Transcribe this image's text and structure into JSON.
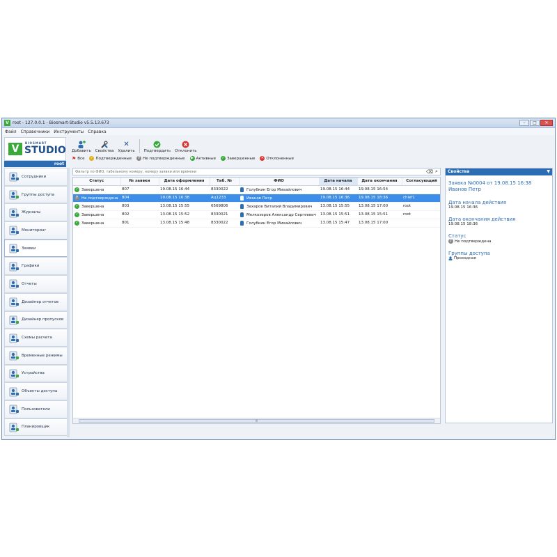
{
  "window": {
    "title": "root - 127.0.0.1 - Biosmart-Studio v5.5.13.673"
  },
  "menu": [
    "Файл",
    "Справочники",
    "Инструменты",
    "Справка"
  ],
  "logo": {
    "small": "BIOSMART",
    "big": "STUDIO",
    "user": "root"
  },
  "sidebar": {
    "items": [
      {
        "label": "Сотрудники",
        "icon": "employees-icon"
      },
      {
        "label": "Группы доступа",
        "icon": "access-groups-icon"
      },
      {
        "label": "Журналы",
        "icon": "journals-icon"
      },
      {
        "label": "Мониторинг",
        "icon": "monitoring-icon"
      },
      {
        "label": "Заявки",
        "icon": "requests-icon"
      },
      {
        "label": "Графики",
        "icon": "schedules-icon"
      },
      {
        "label": "Отчеты",
        "icon": "reports-icon"
      },
      {
        "label": "Дизайнер отчетов",
        "icon": "report-designer-icon"
      },
      {
        "label": "Дизайнер пропусков",
        "icon": "pass-designer-icon"
      },
      {
        "label": "Схемы расчета",
        "icon": "calc-schemes-icon"
      },
      {
        "label": "Временные режимы",
        "icon": "time-modes-icon"
      },
      {
        "label": "Устройства",
        "icon": "devices-icon"
      },
      {
        "label": "Объекты доступа",
        "icon": "access-objects-icon"
      },
      {
        "label": "Пользователи",
        "icon": "users-icon"
      },
      {
        "label": "Планировщик",
        "icon": "scheduler-icon"
      }
    ],
    "active_index": 4
  },
  "toolbar": {
    "add": "Добавить",
    "properties": "Свойства",
    "delete": "Удалить",
    "approve": "Подтвердить",
    "reject": "Отклонить"
  },
  "filters": {
    "all": "Все",
    "approved": "Подтвержденные",
    "not_approved": "Не подтвержденные",
    "active": "Активные",
    "completed": "Завершенные",
    "rejected": "Отклоненные"
  },
  "search": {
    "placeholder": "Фильтр по ФИО, табельному номеру, номеру заявки или времени"
  },
  "table": {
    "columns": [
      "Статус",
      "№ заявки",
      "Дата оформления",
      "Таб. №",
      "ФИО",
      "Дата начала",
      "Дата окончания",
      "Согласующий"
    ],
    "rows": [
      {
        "status": "Завершена",
        "num": "807",
        "created": "19.08.15 16:44",
        "tab": "8330022",
        "fio": "Голубкин Егор Михайлович",
        "start": "19.08.15 16:44",
        "end": "19.08.15 16:54",
        "approver": "",
        "kind": "done"
      },
      {
        "status": "Не подтверждена",
        "num": "804",
        "created": "19.08.15 16:38",
        "tab": "Ац1233",
        "fio": "Иванов Петр",
        "start": "19.08.15 16:36",
        "end": "19.08.15 18:36",
        "approver": "chief1",
        "kind": "pending"
      },
      {
        "status": "Завершена",
        "num": "803",
        "created": "13.08.15 15:55",
        "tab": "6569806",
        "fio": "Захаров Виталий Владимирович",
        "start": "13.08.15 15:55",
        "end": "13.08.15 17:00",
        "approver": "root",
        "kind": "done"
      },
      {
        "status": "Завершена",
        "num": "802",
        "created": "13.08.15 15:52",
        "tab": "8330021",
        "fio": "Мелкозеров Александр Сергеевич",
        "start": "13.08.15 15:51",
        "end": "13.08.15 15:51",
        "approver": "root",
        "kind": "done"
      },
      {
        "status": "Завершена",
        "num": "801",
        "created": "13.08.15 15:48",
        "tab": "8330022",
        "fio": "Голубкин Егор Михайлович",
        "start": "13.08.15 15:47",
        "end": "13.08.15 17:00",
        "approver": "",
        "kind": "done"
      }
    ],
    "selected_index": 1,
    "sorted_column": 5
  },
  "properties": {
    "header": "Свойства",
    "title": "Заявка №0004 от 19.08.15 16:38 Иванов Петр",
    "start_label": "Дата начала действия",
    "start_value": "19.08.15 16:36",
    "end_label": "Дата окончания действия",
    "end_value": "19.08.15 18:36",
    "status_label": "Статус",
    "status_value": "Не подтверждена",
    "groups_label": "Группы доступа",
    "groups_value": "Проходная"
  },
  "colors": {
    "accent": "#2b6cb3",
    "selected_row": "#3c8ee8",
    "done": "#3aa83a",
    "pending": "#8a8a8a",
    "rejected": "#d9352f"
  }
}
